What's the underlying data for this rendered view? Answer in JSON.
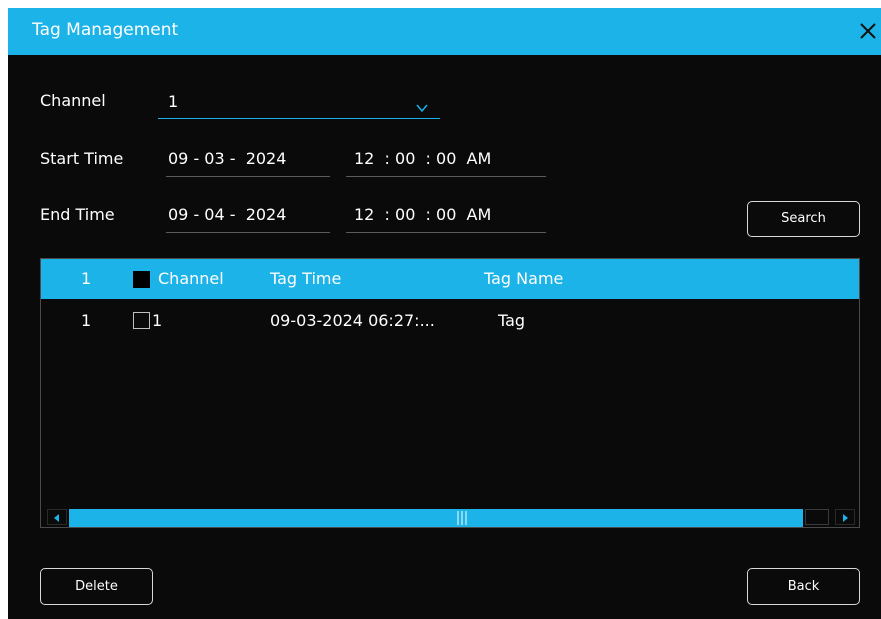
{
  "window": {
    "title": "Tag Management",
    "close_icon": "close-icon"
  },
  "form": {
    "channel_label": "Channel",
    "channel_value": "1",
    "start_time_label": "Start Time",
    "start_date": "09 - 03 -  2024",
    "start_clock": "12  : 00  : 00  AM",
    "end_time_label": "End Time",
    "end_date": "09 - 04 -  2024",
    "end_clock": "12  : 00  : 00  AM",
    "search_label": "Search"
  },
  "table": {
    "header": {
      "index": "1",
      "channel": "Channel",
      "tag_time": "Tag Time",
      "tag_name": "Tag Name"
    },
    "rows": [
      {
        "index": "1",
        "channel": "1",
        "tag_time": "09-03-2024 06:27:...",
        "tag_name": "Tag"
      }
    ]
  },
  "footer": {
    "delete_label": "Delete",
    "back_label": "Back"
  },
  "colors": {
    "accent": "#1bb3e8",
    "background": "#0a0a0a",
    "text": "#ffffff"
  }
}
